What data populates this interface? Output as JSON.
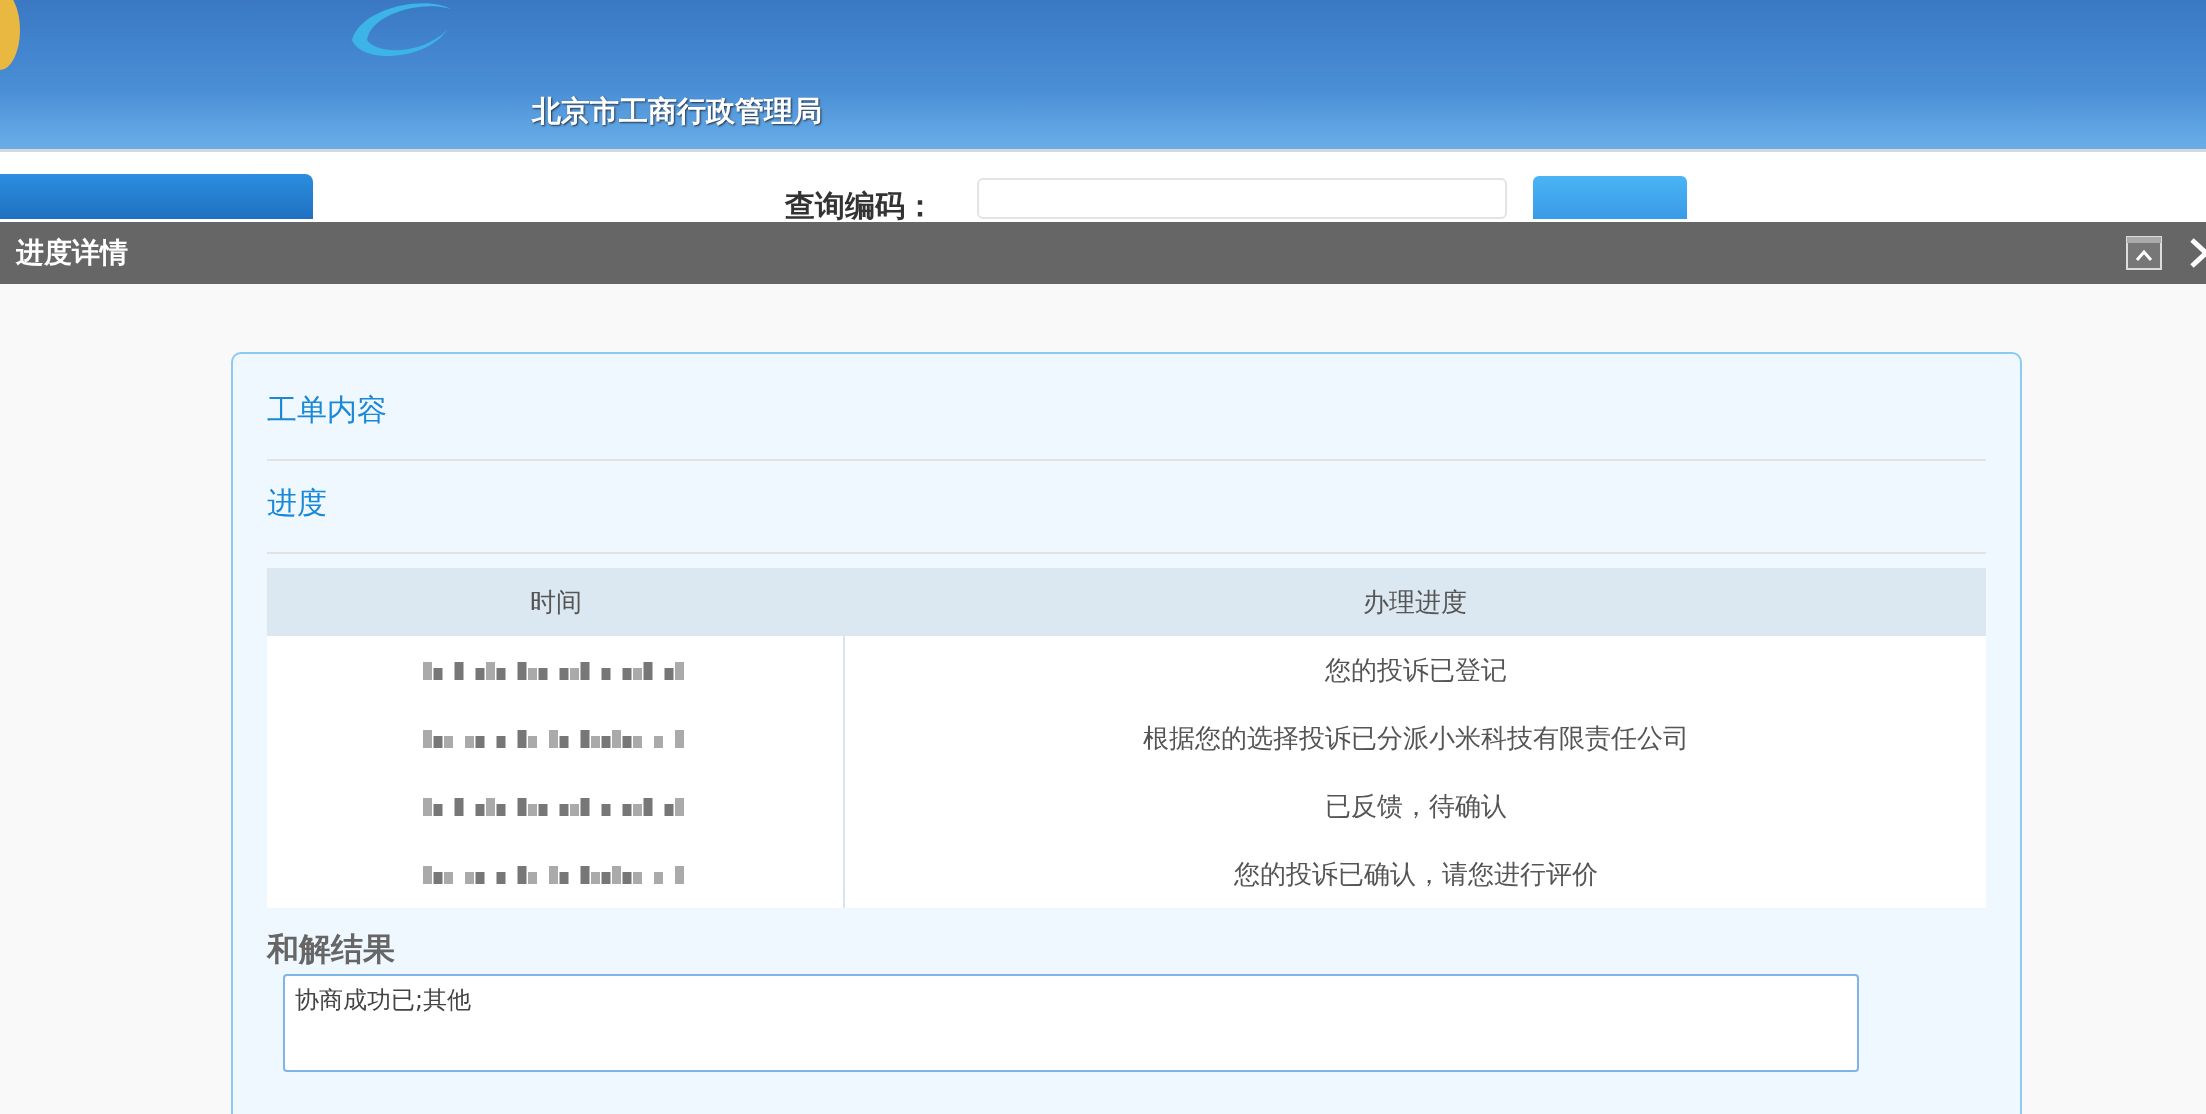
{
  "header": {
    "subtitle": "北京市工商行政管理局"
  },
  "search": {
    "label": "查询编码："
  },
  "dialog": {
    "title": "进度详情",
    "sections": [
      {
        "heading": "工单内容"
      },
      {
        "heading": "进度"
      }
    ],
    "progress_table": {
      "columns": [
        "时间",
        "办理进度"
      ],
      "rows": [
        {
          "progress": "您的投诉已登记"
        },
        {
          "progress": "根据您的选择投诉已分派小米科技有限责任公司"
        },
        {
          "progress": "已反馈，待确认"
        },
        {
          "progress": "您的投诉已确认，请您进行评价"
        }
      ]
    },
    "result": {
      "heading": "和解结果",
      "value": "协商成功已;其他"
    }
  }
}
